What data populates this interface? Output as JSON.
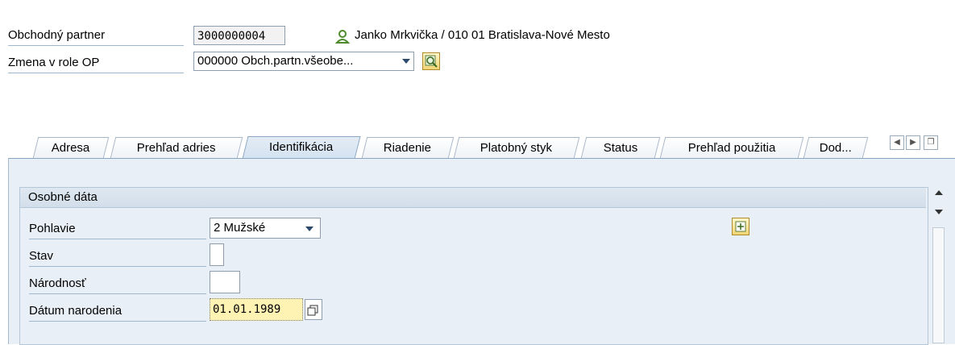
{
  "header": {
    "partner_label": "Obchodný partner",
    "partner_value": "3000000004",
    "partner_description": "Janko Mrkvička / 010 01 Bratislava-Nové Mesto",
    "role_label": "Zmena v role OP",
    "role_value": "000000 Obch.partn.všeobe..."
  },
  "tabs": [
    {
      "label": "Adresa",
      "active": false
    },
    {
      "label": "Prehľad adries",
      "active": false
    },
    {
      "label": "Identifikácia",
      "active": true
    },
    {
      "label": "Riadenie",
      "active": false
    },
    {
      "label": "Platobný styk",
      "active": false
    },
    {
      "label": "Status",
      "active": false
    },
    {
      "label": "Prehľad použitia",
      "active": false
    },
    {
      "label": "Dod...",
      "active": false
    }
  ],
  "group": {
    "title": "Osobné dáta",
    "fields": {
      "gender_label": "Pohlavie",
      "gender_value": "2 Mužské",
      "marital_label": "Stav",
      "marital_value": "",
      "nationality_label": "Národnosť",
      "nationality_value": "",
      "birthdate_label": "Dátum narodenia",
      "birthdate_value": "01.01.1989"
    }
  },
  "icons": {
    "person": "person-icon",
    "search": "search-icon",
    "expand": "expand-icon",
    "calendar": "calendar-icon",
    "tab_left": "tab-scroll-left-icon",
    "tab_right": "tab-scroll-right-icon",
    "tab_list": "tab-list-icon"
  },
  "colors": {
    "accent_bg": "#e8eff6",
    "highlight_input": "#fff3b3"
  }
}
